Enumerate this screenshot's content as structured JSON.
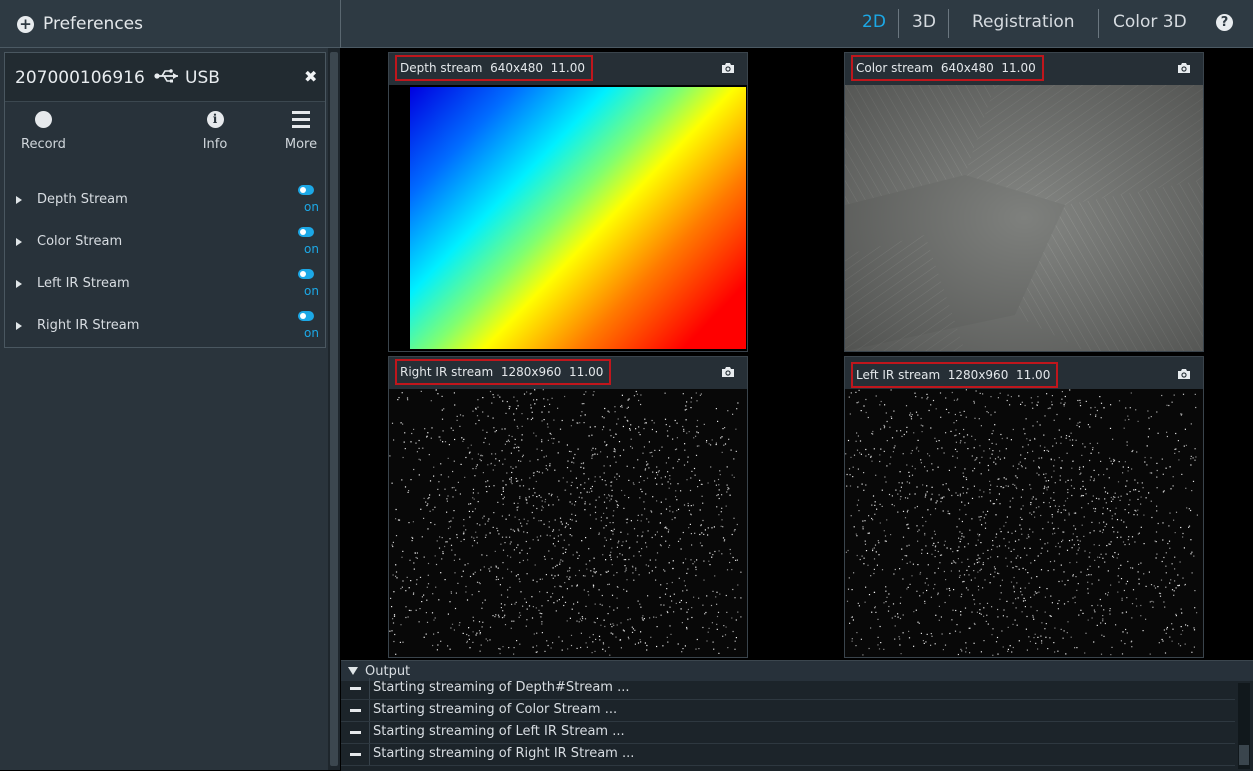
{
  "header": {
    "preferences_label": "Preferences",
    "tabs": [
      {
        "label": "2D",
        "active": true
      },
      {
        "label": "3D",
        "active": false
      },
      {
        "label": "Registration",
        "active": false
      },
      {
        "label": "Color 3D",
        "active": false
      }
    ],
    "help_glyph": "?",
    "accent_color": "#1ca8e6"
  },
  "device": {
    "serial": "207000106916",
    "connection": "USB",
    "close_glyph": "✖",
    "actions": [
      {
        "label": "Record",
        "icon": "record-icon"
      },
      {
        "label": "Info",
        "icon": "info-icon"
      },
      {
        "label": "More",
        "icon": "menu-icon"
      }
    ],
    "streams": [
      {
        "label": "Depth Stream",
        "state": "on"
      },
      {
        "label": "Color Stream",
        "state": "on"
      },
      {
        "label": "Left IR Stream",
        "state": "on"
      },
      {
        "label": "Right IR Stream",
        "state": "on"
      }
    ]
  },
  "viewers": {
    "depth": {
      "name": "Depth stream",
      "resolution": "640x480",
      "fps": "11.00"
    },
    "color": {
      "name": "Color stream",
      "resolution": "640x480",
      "fps": "11.00"
    },
    "right_ir": {
      "name": "Right IR stream",
      "resolution": "1280x960",
      "fps": "11.00"
    },
    "left_ir": {
      "name": "Left IR stream",
      "resolution": "1280x960",
      "fps": "11.00"
    }
  },
  "output": {
    "title": "Output",
    "logs": [
      "Starting streaming of Depth#Stream ...",
      "Starting streaming of Color Stream ...",
      "Starting streaming of Left IR Stream ...",
      "Starting streaming of Right IR Stream ..."
    ]
  }
}
